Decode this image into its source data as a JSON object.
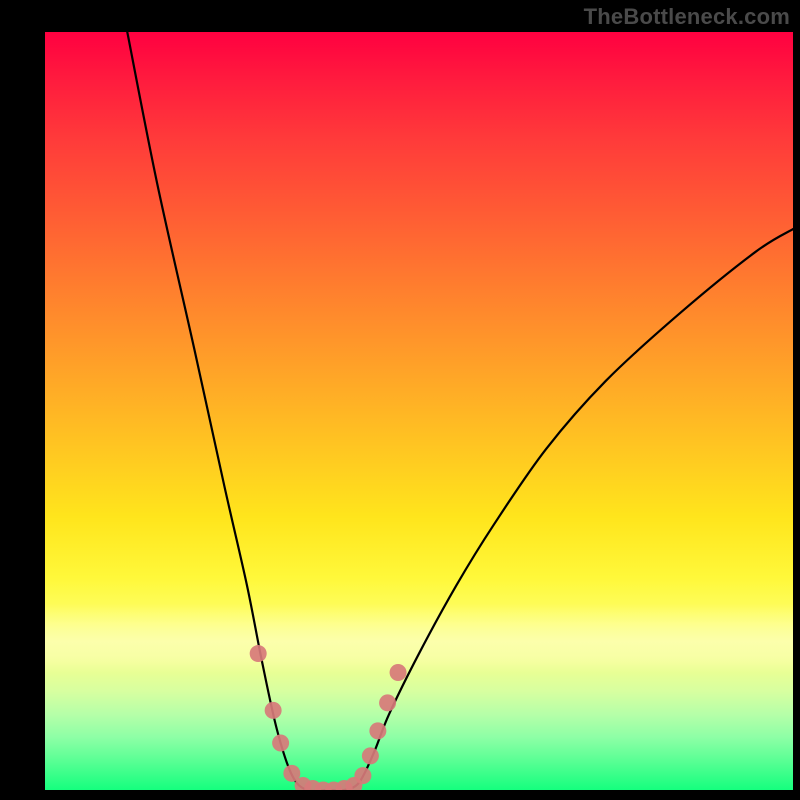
{
  "watermark": "TheBottleneck.com",
  "colors": {
    "page_bg": "#000000",
    "curve_stroke": "#000000",
    "marker_fill": "#d77a7a",
    "gradient_top": "#ff0040",
    "gradient_bottom": "#15ff7e"
  },
  "chart_data": {
    "type": "line",
    "title": "",
    "xlabel": "",
    "ylabel": "",
    "xlim": [
      0,
      100
    ],
    "ylim": [
      0,
      100
    ],
    "grid": false,
    "legend": false,
    "description": "V-shaped bottleneck curve over red-to-green vertical gradient background. Minimum (bottleneck ~0) occurs roughly between x≈33 and x≈42. Left branch rises much more steeply than the right branch.",
    "series": [
      {
        "name": "bottleneck-curve",
        "x": [
          11,
          15,
          20,
          24,
          27,
          29,
          31,
          33,
          35,
          38,
          40,
          42,
          44,
          46,
          50,
          55,
          60,
          67,
          75,
          85,
          95,
          100
        ],
        "values": [
          100,
          80,
          58,
          40,
          27,
          17,
          8,
          2,
          0,
          0,
          0,
          1,
          5,
          10,
          18,
          27,
          35,
          45,
          54,
          63,
          71,
          74
        ]
      }
    ],
    "markers": {
      "name": "highlight-points",
      "x": [
        28.5,
        30.5,
        31.5,
        33,
        34.5,
        35.8,
        37.2,
        38.6,
        40,
        41.3,
        42.5,
        43.5,
        44.5,
        45.8,
        47.2
      ],
      "values": [
        18,
        10.5,
        6.2,
        2.2,
        0.6,
        0.2,
        0.0,
        0.0,
        0.2,
        0.6,
        1.9,
        4.5,
        7.8,
        11.5,
        15.5
      ]
    }
  }
}
